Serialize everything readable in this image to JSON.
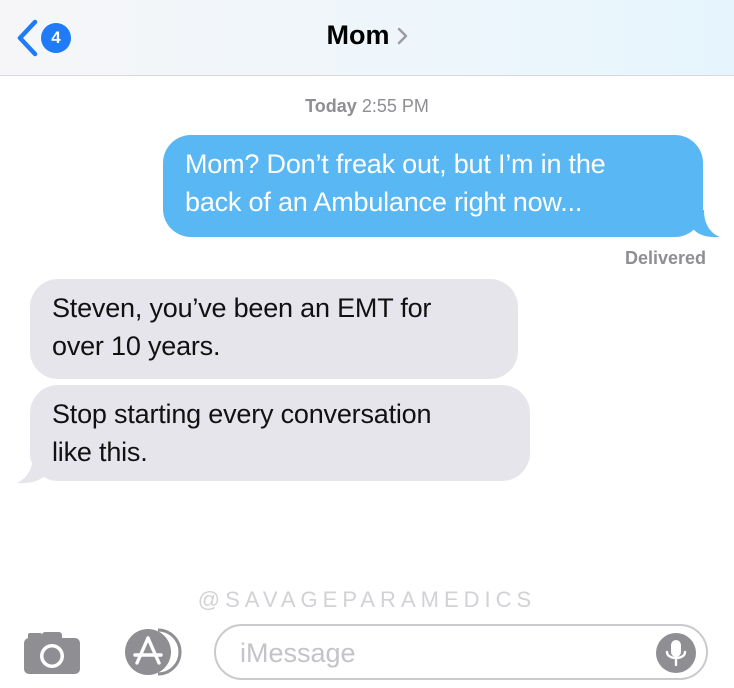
{
  "header": {
    "back_badge_count": "4",
    "contact_name": "Mom"
  },
  "conversation": {
    "timestamp_day": "Today",
    "timestamp_time": "2:55 PM",
    "sent_message": {
      "line1": "Mom? Don’t freak out, but I’m in the",
      "line2": "back of an Ambulance right now..."
    },
    "status": "Delivered",
    "received_messages": [
      {
        "line1": "Steven, you’ve been an EMT for",
        "line2": "over 10 years."
      },
      {
        "line1": "Stop starting every conversation",
        "line2": "like this."
      }
    ]
  },
  "watermark": "@SAVAGEPARAMEDICS",
  "composer": {
    "placeholder": "iMessage"
  },
  "icons": {
    "back": "chevron-left-icon",
    "title_chevron": "chevron-right-icon",
    "camera": "camera-icon",
    "appstore": "app-store-icon",
    "mic": "microphone-icon"
  },
  "colors": {
    "accent": "#1f7bf6",
    "sent_bubble": "#59b7f3",
    "received_bubble": "#e6e5eb",
    "meta_text": "#8e8e93"
  }
}
